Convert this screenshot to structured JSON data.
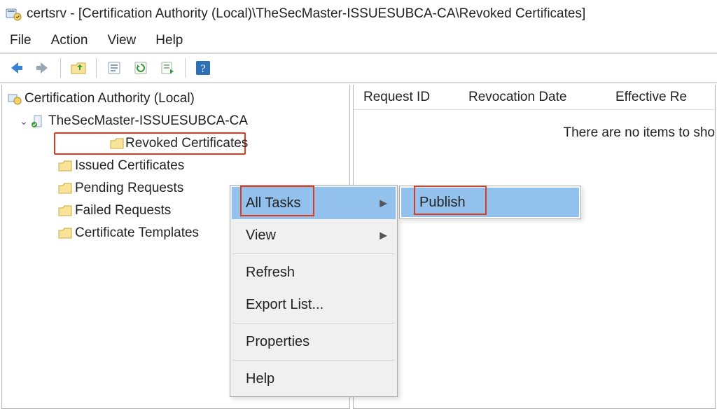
{
  "window": {
    "title": "certsrv - [Certification Authority (Local)\\TheSecMaster-ISSUESUBCA-CA\\Revoked Certificates]"
  },
  "menubar": {
    "file": "File",
    "action": "Action",
    "view": "View",
    "help": "Help"
  },
  "toolbar": {
    "back": "back-icon",
    "forward": "forward-icon",
    "up": "up-folder-icon",
    "properties": "properties-icon",
    "refresh": "refresh-icon",
    "export": "export-icon",
    "help": "help-icon"
  },
  "tree": {
    "root_label": "Certification Authority (Local)",
    "ca_label": "TheSecMaster-ISSUESUBCA-CA",
    "nodes": [
      {
        "label": "Revoked Certificates",
        "selected": true
      },
      {
        "label": "Issued Certificates"
      },
      {
        "label": "Pending Requests"
      },
      {
        "label": "Failed Requests"
      },
      {
        "label": "Certificate Templates"
      }
    ]
  },
  "list": {
    "columns": [
      "Request ID",
      "Revocation Date",
      "Effective Re"
    ],
    "empty_text": "There are no items to sho"
  },
  "context_menu": {
    "items": [
      {
        "label": "All Tasks",
        "submenu": true,
        "highlight": true
      },
      {
        "label": "View",
        "submenu": true
      },
      {
        "sep": true
      },
      {
        "label": "Refresh"
      },
      {
        "label": "Export List..."
      },
      {
        "sep": true
      },
      {
        "label": "Properties"
      },
      {
        "sep": true
      },
      {
        "label": "Help"
      }
    ],
    "submenu": {
      "items": [
        {
          "label": "Publish",
          "highlight": true
        }
      ]
    }
  }
}
